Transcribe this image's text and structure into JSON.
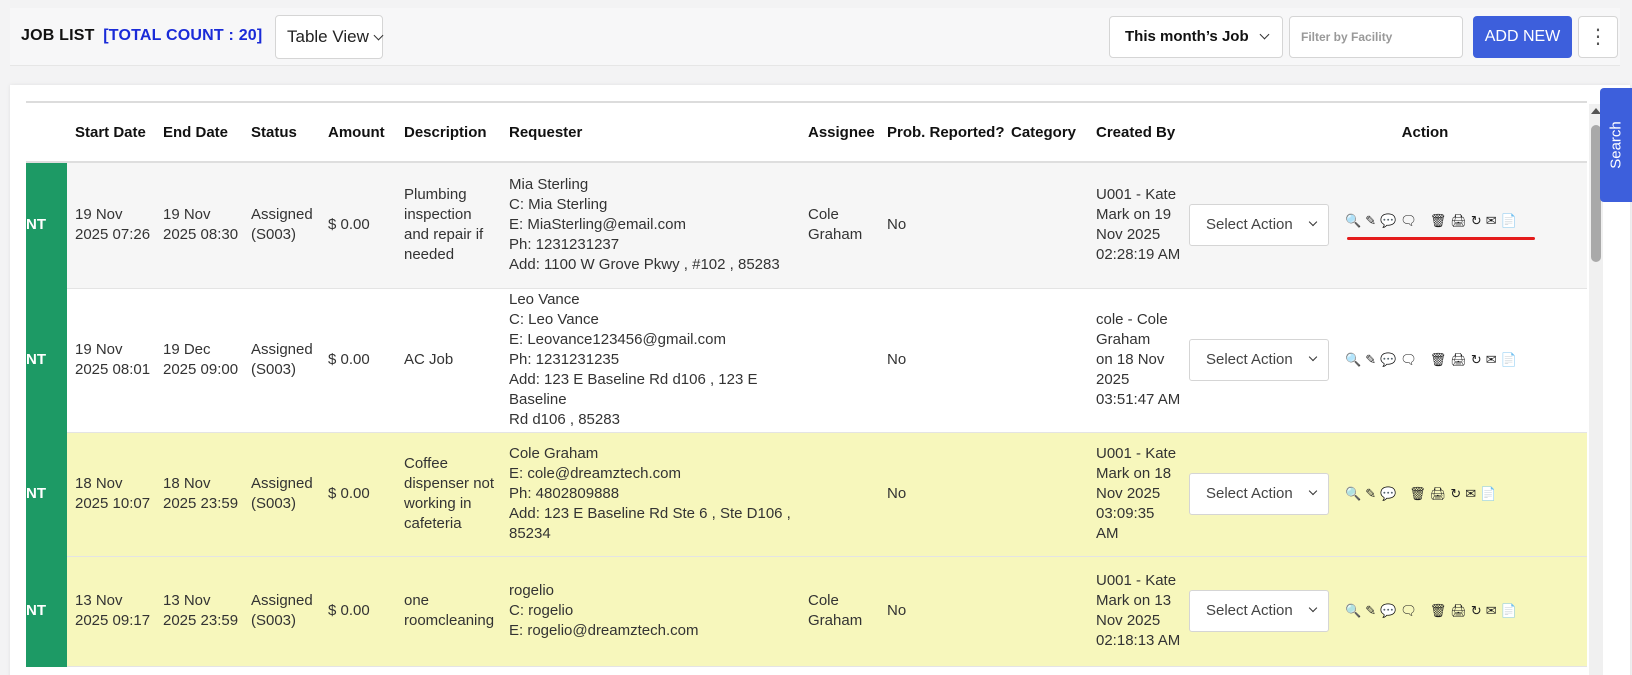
{
  "header": {
    "title": "JOB LIST",
    "count_label": "[TOTAL COUNT : 20]",
    "view_select": "Table View",
    "month_select": "This month’s Job",
    "facility_placeholder": "Filter by Facility",
    "add_button": "ADD NEW",
    "more_icon": "⋮"
  },
  "sidebar_tab": "Search",
  "table": {
    "columns": [
      "Start Date",
      "End Date",
      "Status",
      "Amount",
      "Description",
      "Requester",
      "Assignee",
      "Prob. Reported?",
      "Category",
      "Created By",
      "",
      "Action"
    ],
    "rows": [
      {
        "tag": "NT",
        "start": [
          "19 Nov",
          "2025 07:26"
        ],
        "end": [
          "19 Nov",
          "2025 08:30"
        ],
        "status": [
          "Assigned",
          "(S003)"
        ],
        "amount": "$ 0.00",
        "description": [
          "Plumbing",
          "inspection",
          "and repair if",
          "needed"
        ],
        "requester": [
          "Mia Sterling",
          "C: Mia Sterling",
          "E: MiaSterling@email.com",
          "Ph: 1231231237",
          "Add: 1100 W Grove Pkwy , #102 , 85283"
        ],
        "assignee": [
          "Cole",
          "Graham"
        ],
        "prob_reported": "No",
        "category": "",
        "created_by": [
          "U001 - Kate",
          "Mark on 19",
          "Nov 2025",
          "02:28:19 AM"
        ],
        "select_action": "Select Action"
      },
      {
        "tag": "NT",
        "start": [
          "19 Nov",
          "2025 08:01"
        ],
        "end": [
          "19 Dec",
          "2025 09:00"
        ],
        "status": [
          "Assigned",
          "(S003)"
        ],
        "amount": "$ 0.00",
        "description": [
          "AC Job"
        ],
        "requester": [
          "Leo Vance",
          "C: Leo Vance",
          "E: Leovance123456@gmail.com",
          "Ph: 1231231235",
          "Add: 123 E Baseline Rd d106 , 123 E Baseline",
          "Rd d106 , 85283"
        ],
        "assignee": [],
        "prob_reported": "No",
        "category": "",
        "created_by": [
          "cole - Cole",
          "Graham",
          "on 18 Nov",
          "2025",
          "03:51:47 AM"
        ],
        "select_action": "Select Action"
      },
      {
        "tag": "NT",
        "start": [
          "18 Nov",
          "2025 10:07"
        ],
        "end": [
          "18 Nov",
          "2025 23:59"
        ],
        "status": [
          "Assigned",
          "(S003)"
        ],
        "amount": "$ 0.00",
        "description": [
          "Coffee",
          "dispenser not",
          "working in",
          "cafeteria"
        ],
        "requester": [
          "Cole Graham",
          "E: cole@dreamztech.com",
          "Ph: 4802809888",
          "Add: 123 E Baseline Rd Ste 6 , Ste D106 ,",
          "85234"
        ],
        "assignee": [],
        "prob_reported": "No",
        "category": "",
        "created_by": [
          "U001 - Kate",
          "Mark on 18",
          "Nov 2025",
          "03:09:35",
          "AM"
        ],
        "select_action": "Select Action"
      },
      {
        "tag": "NT",
        "start": [
          "13 Nov",
          "2025 09:17"
        ],
        "end": [
          "13 Nov",
          "2025 23:59"
        ],
        "status": [
          "Assigned",
          "(S003)"
        ],
        "amount": "$ 0.00",
        "description": [
          "one",
          "roomcleaning"
        ],
        "requester": [
          "rogelio",
          "C: rogelio",
          "E: rogelio@dreamztech.com"
        ],
        "assignee": [
          "Cole",
          "Graham"
        ],
        "prob_reported": "No",
        "category": "",
        "created_by": [
          "U001 - Kate",
          "Mark on 13",
          "Nov 2025",
          "02:18:13 AM"
        ],
        "select_action": "Select Action"
      }
    ]
  },
  "action_icons": {
    "view": "🔍",
    "edit": "✎",
    "comment": "💬",
    "chat": "🗨",
    "delete": "🗑",
    "print": "🖨",
    "refresh": "↻",
    "email": "✉",
    "document": "📄"
  },
  "colors": {
    "accent_blue": "#3d5fdc",
    "count_blue": "#1a2bd8",
    "tag_green": "#1d9a65",
    "row_yellow": "#f7f7bc",
    "underline_red": "#e41b1b"
  }
}
